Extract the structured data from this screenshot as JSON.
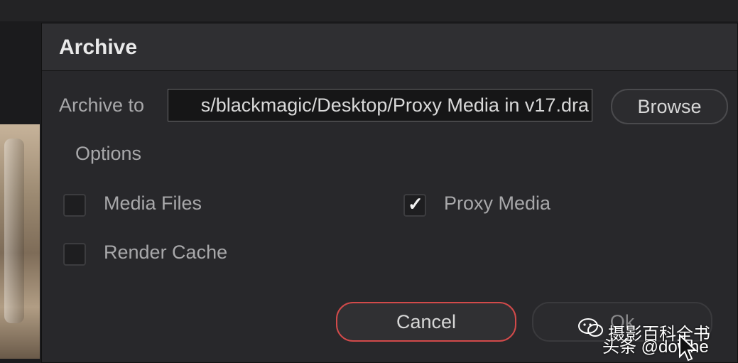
{
  "dialog": {
    "title": "Archive",
    "archive_to_label": "Archive to",
    "archive_path": "s/blackmagic/Desktop/Proxy Media in v17.dra",
    "browse_label": "Browse",
    "options_label": "Options",
    "options": [
      {
        "label": "Media Files",
        "checked": false
      },
      {
        "label": "Proxy Media",
        "checked": true
      },
      {
        "label": "Render Cache",
        "checked": false
      }
    ],
    "cancel_label": "Cancel",
    "ok_label": "Ok",
    "check_glyph": "✓"
  },
  "watermark": {
    "line1": "摄影百科全书",
    "line2": "头条 @dowhe",
    "icon": "wechat-icon"
  },
  "colors": {
    "dialog_bg": "#28282b",
    "cancel_border": "#d24a4a"
  }
}
